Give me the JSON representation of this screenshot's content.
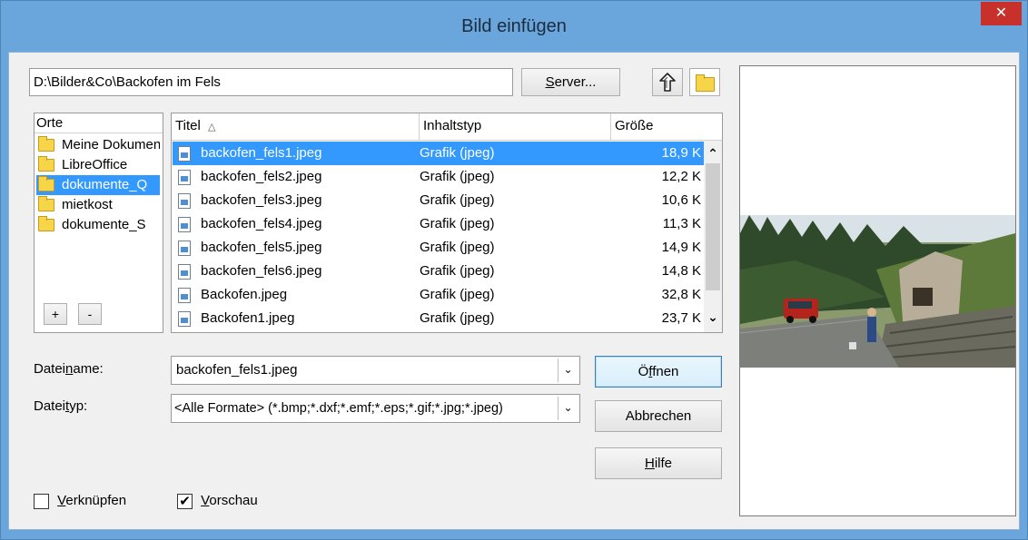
{
  "window": {
    "title": "Bild einfügen",
    "close_glyph": "✕"
  },
  "path": {
    "value": "D:\\Bilder&Co\\Backofen im Fels"
  },
  "toolbar": {
    "server_pre": "",
    "server_u": "S",
    "server_post": "erver...",
    "up_icon": "folder-up-icon",
    "newfolder_icon": "new-folder-icon"
  },
  "places": {
    "header": "Orte",
    "items": [
      {
        "label": "Meine Dokumente"
      },
      {
        "label": "LibreOffice"
      },
      {
        "label": "dokumente_Q"
      },
      {
        "label": "mietkost"
      },
      {
        "label": "dokumente_S"
      }
    ],
    "add_label": "+",
    "remove_label": "-"
  },
  "files": {
    "columns": {
      "title": "Titel",
      "sort_glyph": "△",
      "type": "Inhaltstyp",
      "size": "Größe"
    },
    "rows": [
      {
        "name": "backofen_fels1.jpeg",
        "type": "Grafik (jpeg)",
        "size": "18,9 K"
      },
      {
        "name": "backofen_fels2.jpeg",
        "type": "Grafik (jpeg)",
        "size": "12,2 K"
      },
      {
        "name": "backofen_fels3.jpeg",
        "type": "Grafik (jpeg)",
        "size": "10,6 K"
      },
      {
        "name": "backofen_fels4.jpeg",
        "type": "Grafik (jpeg)",
        "size": "11,3 K"
      },
      {
        "name": "backofen_fels5.jpeg",
        "type": "Grafik (jpeg)",
        "size": "14,9 K"
      },
      {
        "name": "backofen_fels6.jpeg",
        "type": "Grafik (jpeg)",
        "size": "14,8 K"
      },
      {
        "name": "Backofen.jpeg",
        "type": "Grafik (jpeg)",
        "size": "32,8 K"
      },
      {
        "name": "Backofen1.jpeg",
        "type": "Grafik (jpeg)",
        "size": "23,7 K"
      }
    ],
    "scroll_up": "⌃",
    "scroll_down": "⌄"
  },
  "filename": {
    "label_pre": "Datei",
    "label_u": "n",
    "label_post": "ame:",
    "value": "backofen_fels1.jpeg"
  },
  "filetype": {
    "label_pre": "Datei",
    "label_u": "t",
    "label_post": "yp:",
    "value": "<Alle Formate> (*.bmp;*.dxf;*.emf;*.eps;*.gif;*.jpg;*.jpeg)"
  },
  "combo_arrow": "⌄",
  "buttons": {
    "open_pre": "Ö",
    "open_u": "f",
    "open_post": "fnen",
    "cancel": "Abbrechen",
    "help_pre": "",
    "help_u": "H",
    "help_post": "ilfe"
  },
  "options": {
    "link_pre": "",
    "link_u": "V",
    "link_post": "erknüpfen",
    "link_checked": false,
    "preview_pre": "",
    "preview_u": "V",
    "preview_post": "orschau",
    "preview_checked": true,
    "check_glyph": "✔"
  },
  "colors": {
    "selection": "#3399ff",
    "close": "#c7302b",
    "titlebar": "#6aa6db"
  }
}
